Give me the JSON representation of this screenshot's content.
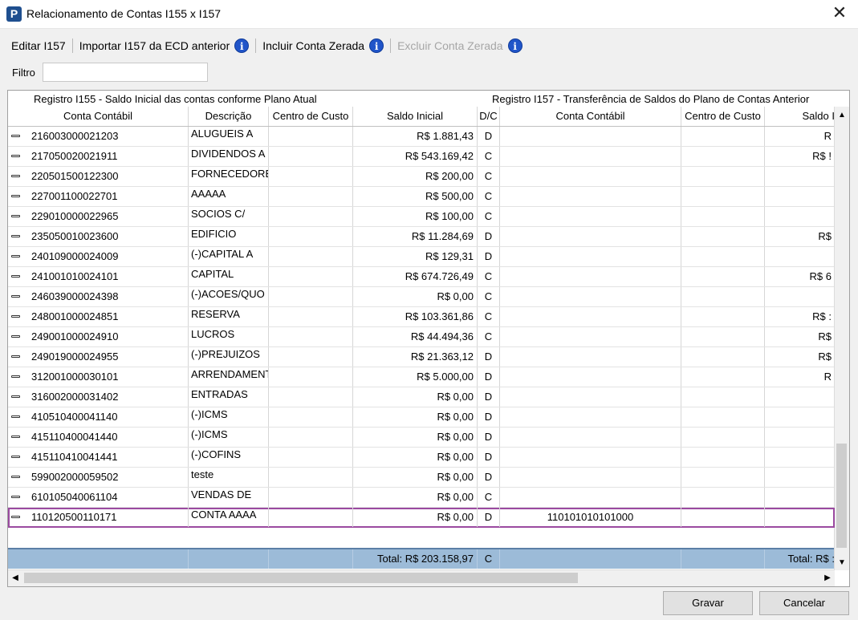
{
  "window": {
    "title": "Relacionamento de Contas I155 x I157",
    "close": "✕",
    "app_letter": "P"
  },
  "toolbar": {
    "editar": "Editar I157",
    "importar": "Importar I157 da ECD anterior",
    "incluir": "Incluir Conta Zerada",
    "excluir": "Excluir Conta Zerada",
    "info": "i"
  },
  "filter": {
    "label": "Filtro",
    "value": ""
  },
  "grid": {
    "group_left": "Registro I155 - Saldo Inicial das contas conforme Plano Atual",
    "group_right": "Registro I157 - Transferência de Saldos do Plano de Contas Anterior",
    "headers": [
      "Conta Contábil",
      "Descrição",
      "Centro de Custo",
      "Saldo Inicial",
      "D/C",
      "Conta Contábil",
      "Centro de Custo",
      "Saldo I"
    ],
    "rows": [
      {
        "conta": "216003000021203",
        "desc": "ALUGUEIS A",
        "saldo": "R$ 1.881,43",
        "dc": "D",
        "conta2": "",
        "saldo2": "R"
      },
      {
        "conta": "217050020021911",
        "desc": "DIVIDENDOS A",
        "saldo": "R$ 543.169,42",
        "dc": "C",
        "conta2": "",
        "saldo2": "R$ !"
      },
      {
        "conta": "220501500122300",
        "desc": "FORNECEDORE",
        "saldo": "R$ 200,00",
        "dc": "C",
        "conta2": "",
        "saldo2": ""
      },
      {
        "conta": "227001100022701",
        "desc": "AAAAA",
        "saldo": "R$ 500,00",
        "dc": "C",
        "conta2": "",
        "saldo2": ""
      },
      {
        "conta": "229010000022965",
        "desc": "SOCIOS C/",
        "saldo": "R$ 100,00",
        "dc": "C",
        "conta2": "",
        "saldo2": ""
      },
      {
        "conta": "235050010023600",
        "desc": "EDIFICIO",
        "saldo": "R$ 11.284,69",
        "dc": "D",
        "conta2": "",
        "saldo2": "R$"
      },
      {
        "conta": "240109000024009",
        "desc": "(-)CAPITAL A",
        "saldo": "R$ 129,31",
        "dc": "D",
        "conta2": "",
        "saldo2": ""
      },
      {
        "conta": "241001010024101",
        "desc": "CAPITAL",
        "saldo": "R$ 674.726,49",
        "dc": "C",
        "conta2": "",
        "saldo2": "R$ 6"
      },
      {
        "conta": "246039000024398",
        "desc": "(-)ACOES/QUO",
        "saldo": "R$ 0,00",
        "dc": "C",
        "conta2": "",
        "saldo2": ""
      },
      {
        "conta": "248001000024851",
        "desc": "RESERVA",
        "saldo": "R$ 103.361,86",
        "dc": "C",
        "conta2": "",
        "saldo2": "R$ :"
      },
      {
        "conta": "249001000024910",
        "desc": "LUCROS",
        "saldo": "R$ 44.494,36",
        "dc": "C",
        "conta2": "",
        "saldo2": "R$"
      },
      {
        "conta": "249019000024955",
        "desc": "(-)PREJUIZOS",
        "saldo": "R$ 21.363,12",
        "dc": "D",
        "conta2": "",
        "saldo2": "R$"
      },
      {
        "conta": "312001000030101",
        "desc": "ARRENDAMENT",
        "saldo": "R$ 5.000,00",
        "dc": "D",
        "conta2": "",
        "saldo2": "R"
      },
      {
        "conta": "316002000031402",
        "desc": "ENTRADAS",
        "saldo": "R$ 0,00",
        "dc": "D",
        "conta2": "",
        "saldo2": ""
      },
      {
        "conta": "410510400041140",
        "desc": "(-)ICMS",
        "saldo": "R$ 0,00",
        "dc": "D",
        "conta2": "",
        "saldo2": ""
      },
      {
        "conta": "415110400041440",
        "desc": "(-)ICMS",
        "saldo": "R$ 0,00",
        "dc": "D",
        "conta2": "",
        "saldo2": ""
      },
      {
        "conta": "415110410041441",
        "desc": "(-)COFINS",
        "saldo": "R$ 0,00",
        "dc": "D",
        "conta2": "",
        "saldo2": ""
      },
      {
        "conta": "599002000059502",
        "desc": "teste",
        "saldo": "R$ 0,00",
        "dc": "D",
        "conta2": "",
        "saldo2": ""
      },
      {
        "conta": "610105040061104",
        "desc": "VENDAS DE",
        "saldo": "R$ 0,00",
        "dc": "C",
        "conta2": "",
        "saldo2": ""
      },
      {
        "conta": "110120500110171",
        "desc": "CONTA AAAA",
        "saldo": "R$ 0,00",
        "dc": "D",
        "conta2": "110101010101000",
        "saldo2": ""
      }
    ],
    "selected_index": 19,
    "totals": {
      "saldo": "Total: R$ 203.158,97",
      "dc": "C",
      "saldo2": "Total: R$ :"
    }
  },
  "buttons": {
    "gravar": "Gravar",
    "cancelar": "Cancelar"
  },
  "colors": {
    "selection_outline": "#9b4aa0",
    "total_bar": "#9cbbd8",
    "info_icon": "#2155c9"
  }
}
